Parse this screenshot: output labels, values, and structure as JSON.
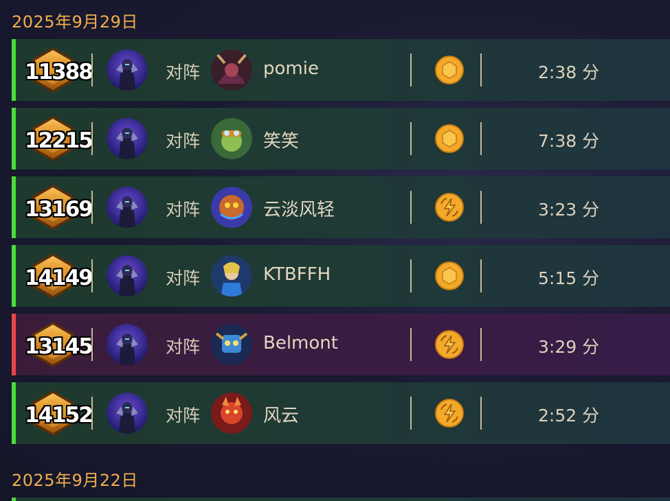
{
  "sections": [
    {
      "date": "2025年9月29日",
      "matches": [
        {
          "rank": "11388",
          "vs": "对阵",
          "opponent": "pomie",
          "result_icon": "coin-icon",
          "duration": "2:38 分",
          "outcome": "win",
          "opponent_avatar": "demon-hunter-portrait"
        },
        {
          "rank": "12215",
          "vs": "对阵",
          "opponent": "笑笑",
          "result_icon": "coin-icon",
          "duration": "7:38 分",
          "outcome": "win",
          "opponent_avatar": "goblin-engineer-portrait"
        },
        {
          "rank": "13169",
          "vs": "对阵",
          "opponent": "云淡风轻",
          "result_icon": "lightning-icon",
          "duration": "3:23 分",
          "outcome": "win",
          "opponent_avatar": "nerubian-portrait"
        },
        {
          "rank": "14149",
          "vs": "对阵",
          "opponent": "KTBFFH",
          "result_icon": "coin-icon",
          "duration": "5:15 分",
          "outcome": "win",
          "opponent_avatar": "paladin-portrait"
        },
        {
          "rank": "13145",
          "vs": "对阵",
          "opponent": "Belmont",
          "result_icon": "lightning-icon",
          "duration": "3:29 分",
          "outcome": "loss",
          "opponent_avatar": "robot-portrait"
        },
        {
          "rank": "14152",
          "vs": "对阵",
          "opponent": "风云",
          "result_icon": "lightning-icon",
          "duration": "2:52 分",
          "outcome": "win",
          "opponent_avatar": "fire-demon-portrait"
        }
      ]
    },
    {
      "date": "2025年9月22日",
      "matches": []
    }
  ],
  "colors": {
    "win": "#4cdc3a",
    "loss": "#e54646",
    "date": "#f0b04a",
    "coin": "#f3a92a"
  }
}
